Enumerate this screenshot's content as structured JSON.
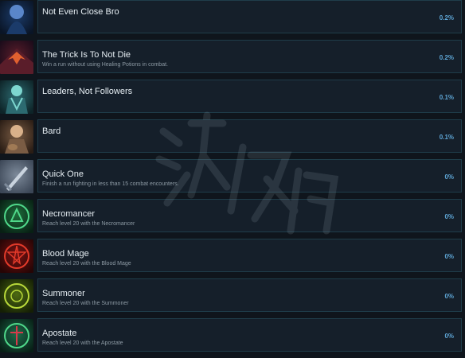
{
  "achievements": [
    {
      "title": "Not Even Close Bro",
      "description": "",
      "percent": "0.2%",
      "icon": "hooded-figure-icon",
      "colors": [
        "#1b3b6a",
        "#0a1526",
        "#5a86c9"
      ]
    },
    {
      "title": "The Trick Is To Not Die",
      "description": "Win a run without using Healing Potions in combat.",
      "percent": "0.2%",
      "icon": "fiery-demon-icon",
      "colors": [
        "#5a1d2a",
        "#1a0b1a",
        "#e0602f"
      ]
    },
    {
      "title": "Leaders, Not Followers",
      "description": "",
      "percent": "0.1%",
      "icon": "armored-warrior-icon",
      "colors": [
        "#2c6a70",
        "#0e2428",
        "#7dd6cf"
      ]
    },
    {
      "title": "Bard",
      "description": "",
      "percent": "0.1%",
      "icon": "bard-portrait-icon",
      "colors": [
        "#7a5c44",
        "#2a1d15",
        "#d8b08a"
      ]
    },
    {
      "title": "Quick One",
      "description": "Finish a run fighting in less than 15 combat encounters.",
      "percent": "0%",
      "icon": "sword-icon",
      "colors": [
        "#7d8a9a",
        "#3b4656",
        "#c9d3de"
      ]
    },
    {
      "title": "Necromancer",
      "description": "Reach level 20 with the Necromancer",
      "percent": "0%",
      "icon": "necromancer-sigil-icon",
      "colors": [
        "#1d6b3a",
        "#082014",
        "#4fd88a"
      ]
    },
    {
      "title": "Blood Mage",
      "description": "Reach level 20 with the Blood Mage",
      "percent": "0%",
      "icon": "blood-mage-sigil-icon",
      "colors": [
        "#7a1212",
        "#260505",
        "#e23a2a"
      ]
    },
    {
      "title": "Summoner",
      "description": "Reach level 20 with the Summoner",
      "percent": "0%",
      "icon": "summoner-sigil-icon",
      "colors": [
        "#4d6a12",
        "#151f05",
        "#b8d83a"
      ]
    },
    {
      "title": "Apostate",
      "description": "Reach level 20 with the Apostate",
      "percent": "0%",
      "icon": "apostate-sigil-icon",
      "colors": [
        "#1d6b4a",
        "#081f16",
        "#d83a4a"
      ]
    }
  ]
}
